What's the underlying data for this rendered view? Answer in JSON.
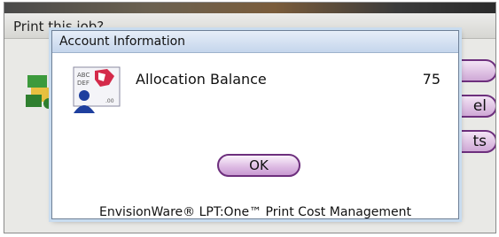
{
  "background_window": {
    "title": "Print this job?",
    "buttons": [
      {
        "label": ""
      },
      {
        "label": "el"
      },
      {
        "label": "ts"
      }
    ]
  },
  "dialog": {
    "title": "Account Information",
    "icon": "account-card-icon",
    "balance_label": "Allocation Balance",
    "balance_value": "75",
    "ok_label": "OK",
    "footer": "EnvisionWare® LPT:One™ Print Cost Management"
  },
  "colors": {
    "button_border": "#6d2f7d",
    "button_fill": "#dcb9e2",
    "dialog_title_bar": "#c5d6ec"
  }
}
